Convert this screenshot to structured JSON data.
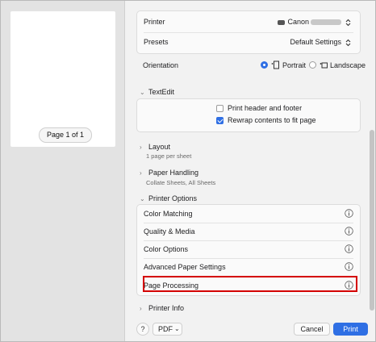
{
  "preview": {
    "page_indicator": "Page 1 of 1"
  },
  "printer_group": {
    "printer_label": "Printer",
    "printer_value": "Canon",
    "presets_label": "Presets",
    "presets_value": "Default Settings"
  },
  "orientation": {
    "label": "Orientation",
    "portrait": "Portrait",
    "landscape": "Landscape",
    "selected": "Portrait"
  },
  "textedit": {
    "title": "TextEdit",
    "options": [
      {
        "label": "Print header and footer",
        "checked": false
      },
      {
        "label": "Rewrap contents to fit page",
        "checked": true
      }
    ]
  },
  "layout": {
    "title": "Layout",
    "summary": "1 page per sheet"
  },
  "paper_handling": {
    "title": "Paper Handling",
    "summary": "Collate Sheets, All Sheets"
  },
  "printer_options": {
    "title": "Printer Options",
    "items": [
      {
        "label": "Color Matching"
      },
      {
        "label": "Quality & Media"
      },
      {
        "label": "Color Options"
      },
      {
        "label": "Advanced Paper Settings"
      },
      {
        "label": "Page Processing"
      }
    ]
  },
  "printer_info": {
    "title": "Printer Info"
  },
  "footer": {
    "help": "?",
    "pdf": "PDF",
    "cancel": "Cancel",
    "print": "Print"
  },
  "colors": {
    "accent": "#2f6fe4",
    "highlight_border": "#d40000"
  }
}
